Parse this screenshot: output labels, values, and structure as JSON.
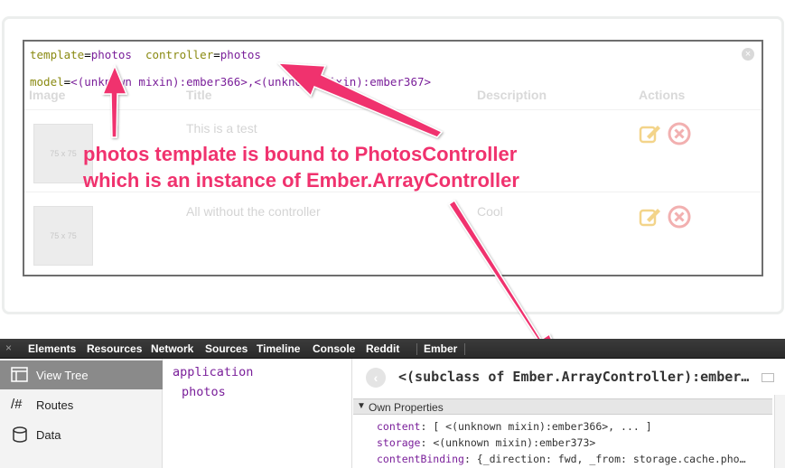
{
  "overlay": {
    "line1": {
      "k1": "template",
      "eq1": "=",
      "v1": "photos",
      "k2": "controller",
      "eq2": "=",
      "v2": "photos"
    },
    "line2": {
      "k": "model",
      "eq": "=",
      "v": "<(unknown mixin):ember366>,<(unknown mixin):ember367>"
    }
  },
  "table": {
    "headers": [
      "Image",
      "Title",
      "Description",
      "Actions"
    ],
    "rows": [
      {
        "thumb": "75 x 75",
        "title": "This is a test",
        "description": ""
      },
      {
        "thumb": "75 x 75",
        "title": "All without the controller",
        "description": "Cool"
      }
    ]
  },
  "annotation": {
    "line1": "photos template is bound to PhotosController",
    "line2": "which is an instance of Ember.ArrayController"
  },
  "devtools": {
    "close_glyph": "×",
    "tabs": [
      "Elements",
      "Resources",
      "Network",
      "Sources",
      "Timeline",
      "Console",
      "Reddit",
      "Ember"
    ],
    "sidebar": [
      {
        "label": "View Tree",
        "icon": "view-tree-icon",
        "active": true
      },
      {
        "label": "Routes",
        "icon": "routes-icon",
        "icon_text": "/#"
      },
      {
        "label": "Data",
        "icon": "database-icon"
      }
    ],
    "tree": [
      "application",
      "photos"
    ],
    "inspector": {
      "back_glyph": "‹",
      "title": "<(subclass of Ember.ArrayController):ember…",
      "section": "Own Properties",
      "section_glyph": "▼",
      "props": [
        {
          "key": "content",
          "value": ": [ <(unknown mixin):ember366>, ... ]"
        },
        {
          "key": "storage",
          "value": ": <(unknown mixin):ember373>"
        },
        {
          "key": "contentBinding",
          "value": ": {_direction: fwd, _from: storage.cache.pho…"
        }
      ]
    }
  },
  "colors": {
    "annotation": "#f0326e",
    "key": "#8a8a12",
    "value": "#7a1f9a"
  }
}
